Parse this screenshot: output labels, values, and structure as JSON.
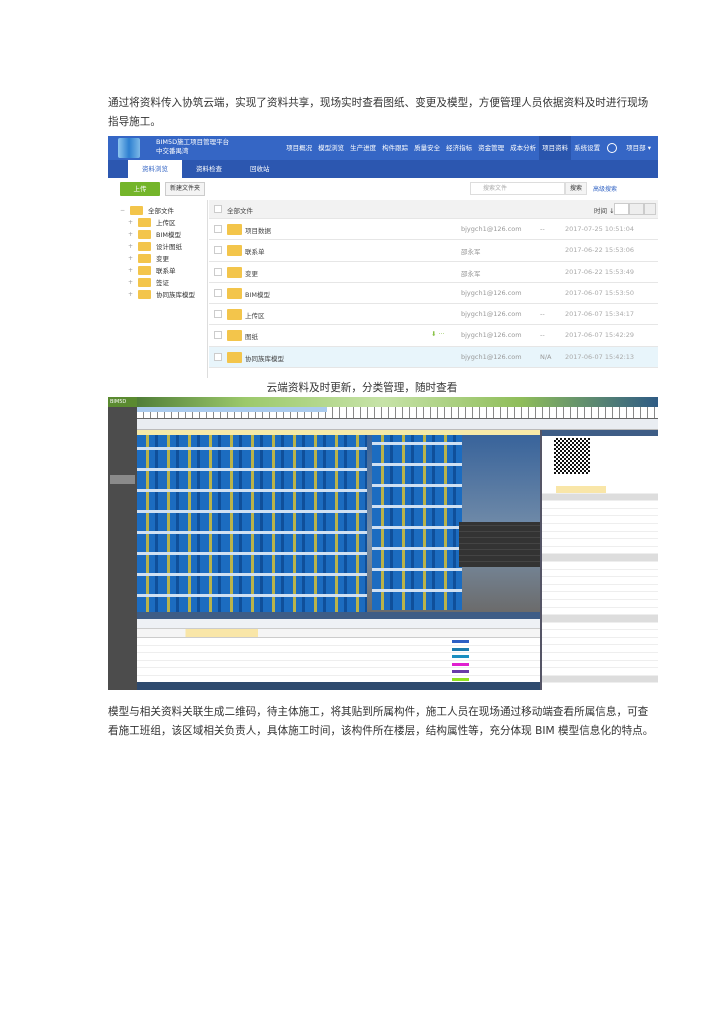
{
  "paragraph1": "通过将资料传入协筑云端，实现了资料共享，现场实时查看图纸、变更及模型，方便管理人员依据资料及时进行现场指导施工。",
  "caption1": "云端资料及时更新，分类管理，随时查看",
  "paragraph2": "模型与相关资料关联生成二维码，待主体施工，将其贴到所属构件，施工人员在现场通过移动端查看所属信息，可查看施工班组，该区域相关负责人，具体施工时间，该构件所在楼层，结构属性等，充分体现 BIM 模型信息化的特点。",
  "platform": {
    "title": "BIM5D施工项目管理平台",
    "project": "中交番禺湾",
    "nav": [
      "项目概况",
      "模型浏览",
      "生产进度",
      "构件跟踪",
      "质量安全",
      "经济指标",
      "资金管理",
      "成本分析",
      "项目资料",
      "系统设置"
    ],
    "user": "项目部 ▾",
    "subtabs": [
      "资料浏览",
      "资料检查",
      "回收站"
    ],
    "upload": "上传",
    "new_folder": "新建文件夹",
    "search_placeholder": "搜索文件",
    "search_button": "搜索",
    "advanced_search": "高级搜索",
    "tree": [
      "全部文件",
      "上传区",
      "BIM模型",
      "设计图纸",
      "变更",
      "联系单",
      "签证",
      "协同族库模型"
    ],
    "list_header": "全部文件",
    "sort_label": "时间 ↓",
    "rows": [
      {
        "name": "项目数据",
        "owner": "bjygch1@126.com",
        "size": "--",
        "time": "2017-07-25 10:51:04"
      },
      {
        "name": "联系单",
        "owner": "邵永军",
        "size": "",
        "time": "2017-06-22 15:53:06"
      },
      {
        "name": "变更",
        "owner": "邵永军",
        "size": "",
        "time": "2017-06-22 15:53:49"
      },
      {
        "name": "BIM模型",
        "owner": "bjygch1@126.com",
        "size": "",
        "time": "2017-06-07 15:53:50"
      },
      {
        "name": "上传区",
        "owner": "bjygch1@126.com",
        "size": "--",
        "time": "2017-06-07 15:34:17"
      },
      {
        "name": "图纸",
        "owner": "bjygch1@126.com",
        "size": "--",
        "time": "2017-06-07 15:42:29"
      },
      {
        "name": "协同族库模型",
        "owner": "bjygch1@126.com",
        "size": "N/A",
        "time": "2017-06-07 15:42:13"
      }
    ]
  },
  "bim_app": {
    "brand": "BIM5D",
    "gantt_colors": [
      "#2d5fc4",
      "#1b7cad",
      "#1b8fc0",
      "#e020d0",
      "#6a3aa8",
      "#90e020",
      "#90e020"
    ]
  }
}
